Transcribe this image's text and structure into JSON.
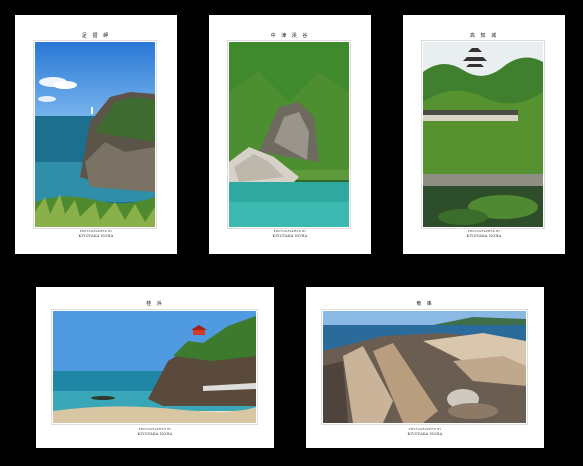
{
  "cards": [
    {
      "title": "足 摺 岬",
      "credit1": "PHOTOGRAPHED BY",
      "credit2": "KIYOTAKA NOHA"
    },
    {
      "title": "中 津 渓 谷",
      "credit1": "PHOTOGRAPHED BY",
      "credit2": "KIYOTAKA NOHA"
    },
    {
      "title": "高 知 城",
      "credit1": "PHOTOGRAPHED BY",
      "credit2": "KIYOTAKA NOHA"
    },
    {
      "title": "桂 浜",
      "credit1": "PHOTOGRAPHED BY",
      "credit2": "KIYOTAKA NOHA"
    },
    {
      "title": "竜 串",
      "credit1": "PHOTOGRAPHED BY",
      "credit2": "KIYOTAKA NOHA"
    }
  ]
}
